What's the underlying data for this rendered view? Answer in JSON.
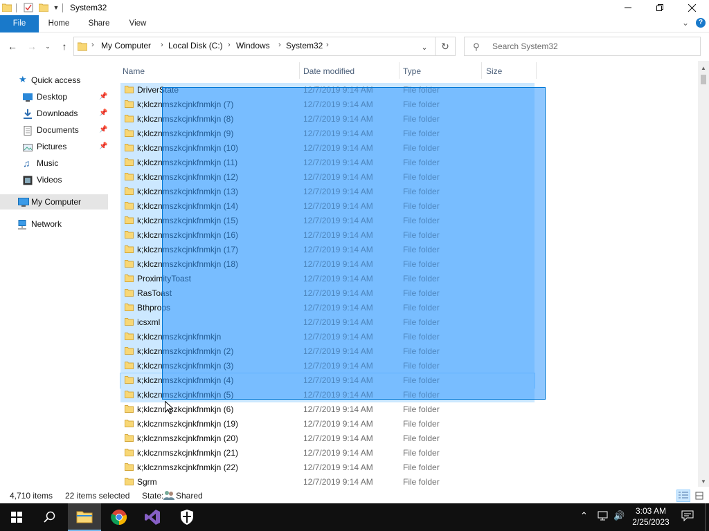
{
  "window": {
    "title": "System32",
    "minimize_icon": "minimize-icon",
    "maximize_icon": "restore-icon",
    "close_icon": "close-icon"
  },
  "ribbon": {
    "tabs": [
      {
        "label": "File"
      },
      {
        "label": "Home"
      },
      {
        "label": "Share"
      },
      {
        "label": "View"
      }
    ],
    "expand_icon": "chevron-down-icon",
    "help_icon": "help-icon",
    "accent_color": "#1979ca"
  },
  "address": {
    "crumbs": [
      "My Computer",
      "Local Disk (C:)",
      "Windows",
      "System32"
    ],
    "search_placeholder": "Search System32"
  },
  "nav": {
    "items": [
      {
        "label": "Quick access",
        "icon": "star-icon"
      },
      {
        "label": "Desktop",
        "icon": "desktop-icon",
        "pinned": true
      },
      {
        "label": "Downloads",
        "icon": "download-icon",
        "pinned": true
      },
      {
        "label": "Documents",
        "icon": "documents-icon",
        "pinned": true
      },
      {
        "label": "Pictures",
        "icon": "pictures-icon",
        "pinned": true
      },
      {
        "label": "Music",
        "icon": "music-icon"
      },
      {
        "label": "Videos",
        "icon": "videos-icon"
      },
      {
        "label": "My Computer",
        "icon": "computer-icon",
        "selected": true
      },
      {
        "label": "Network",
        "icon": "network-icon"
      }
    ]
  },
  "columns": [
    "Name",
    "Date modified",
    "Type",
    "Size"
  ],
  "files": [
    {
      "name": "DriverState",
      "date": "12/7/2019 9:14 AM",
      "type": "File folder",
      "selected": true
    },
    {
      "name": "k;klcznmszkcjnkfnmkjn (7)",
      "date": "12/7/2019 9:14 AM",
      "type": "File folder",
      "selected": true
    },
    {
      "name": "k;klcznmszkcjnkfnmkjn (8)",
      "date": "12/7/2019 9:14 AM",
      "type": "File folder",
      "selected": true
    },
    {
      "name": "k;klcznmszkcjnkfnmkjn (9)",
      "date": "12/7/2019 9:14 AM",
      "type": "File folder",
      "selected": true
    },
    {
      "name": "k;klcznmszkcjnkfnmkjn (10)",
      "date": "12/7/2019 9:14 AM",
      "type": "File folder",
      "selected": true
    },
    {
      "name": "k;klcznmszkcjnkfnmkjn (11)",
      "date": "12/7/2019 9:14 AM",
      "type": "File folder",
      "selected": true
    },
    {
      "name": "k;klcznmszkcjnkfnmkjn (12)",
      "date": "12/7/2019 9:14 AM",
      "type": "File folder",
      "selected": true
    },
    {
      "name": "k;klcznmszkcjnkfnmkjn (13)",
      "date": "12/7/2019 9:14 AM",
      "type": "File folder",
      "selected": true
    },
    {
      "name": "k;klcznmszkcjnkfnmkjn (14)",
      "date": "12/7/2019 9:14 AM",
      "type": "File folder",
      "selected": true
    },
    {
      "name": "k;klcznmszkcjnkfnmkjn (15)",
      "date": "12/7/2019 9:14 AM",
      "type": "File folder",
      "selected": true
    },
    {
      "name": "k;klcznmszkcjnkfnmkjn (16)",
      "date": "12/7/2019 9:14 AM",
      "type": "File folder",
      "selected": true
    },
    {
      "name": "k;klcznmszkcjnkfnmkjn (17)",
      "date": "12/7/2019 9:14 AM",
      "type": "File folder",
      "selected": true
    },
    {
      "name": "k;klcznmszkcjnkfnmkjn (18)",
      "date": "12/7/2019 9:14 AM",
      "type": "File folder",
      "selected": true
    },
    {
      "name": "ProximityToast",
      "date": "12/7/2019 9:14 AM",
      "type": "File folder",
      "selected": true
    },
    {
      "name": "RasToast",
      "date": "12/7/2019 9:14 AM",
      "type": "File folder",
      "selected": true
    },
    {
      "name": "Bthprops",
      "date": "12/7/2019 9:14 AM",
      "type": "File folder",
      "selected": true
    },
    {
      "name": "icsxml",
      "date": "12/7/2019 9:14 AM",
      "type": "File folder",
      "selected": true
    },
    {
      "name": "k;klcznmszkcjnkfnmkjn",
      "date": "12/7/2019 9:14 AM",
      "type": "File folder",
      "selected": true
    },
    {
      "name": "k;klcznmszkcjnkfnmkjn (2)",
      "date": "12/7/2019 9:14 AM",
      "type": "File folder",
      "selected": true
    },
    {
      "name": "k;klcznmszkcjnkfnmkjn (3)",
      "date": "12/7/2019 9:14 AM",
      "type": "File folder",
      "selected": true
    },
    {
      "name": "k;klcznmszkcjnkfnmkjn (4)",
      "date": "12/7/2019 9:14 AM",
      "type": "File folder",
      "selected": true,
      "focus": true
    },
    {
      "name": "k;klcznmszkcjnkfnmkjn (5)",
      "date": "12/7/2019 9:14 AM",
      "type": "File folder",
      "selected": true
    },
    {
      "name": "k;klcznmszkcjnkfnmkjn (6)",
      "date": "12/7/2019 9:14 AM",
      "type": "File folder"
    },
    {
      "name": "k;klcznmszkcjnkfnmkjn (19)",
      "date": "12/7/2019 9:14 AM",
      "type": "File folder"
    },
    {
      "name": "k;klcznmszkcjnkfnmkjn (20)",
      "date": "12/7/2019 9:14 AM",
      "type": "File folder"
    },
    {
      "name": "k;klcznmszkcjnkfnmkjn (21)",
      "date": "12/7/2019 9:14 AM",
      "type": "File folder"
    },
    {
      "name": "k;klcznmszkcjnkfnmkjn (22)",
      "date": "12/7/2019 9:14 AM",
      "type": "File folder"
    },
    {
      "name": "Sgrm",
      "date": "12/7/2019 9:14 AM",
      "type": "File folder"
    }
  ],
  "status": {
    "item_count": "4,710 items",
    "selected_count": "22 items selected",
    "state_label": "State:",
    "state_value": "Shared"
  },
  "taskbar": {
    "apps": [
      "start-icon",
      "search-icon",
      "file-explorer-icon",
      "chrome-icon",
      "visual-studio-icon",
      "windows-security-icon"
    ],
    "time": "3:03 AM",
    "date": "2/25/2023"
  }
}
